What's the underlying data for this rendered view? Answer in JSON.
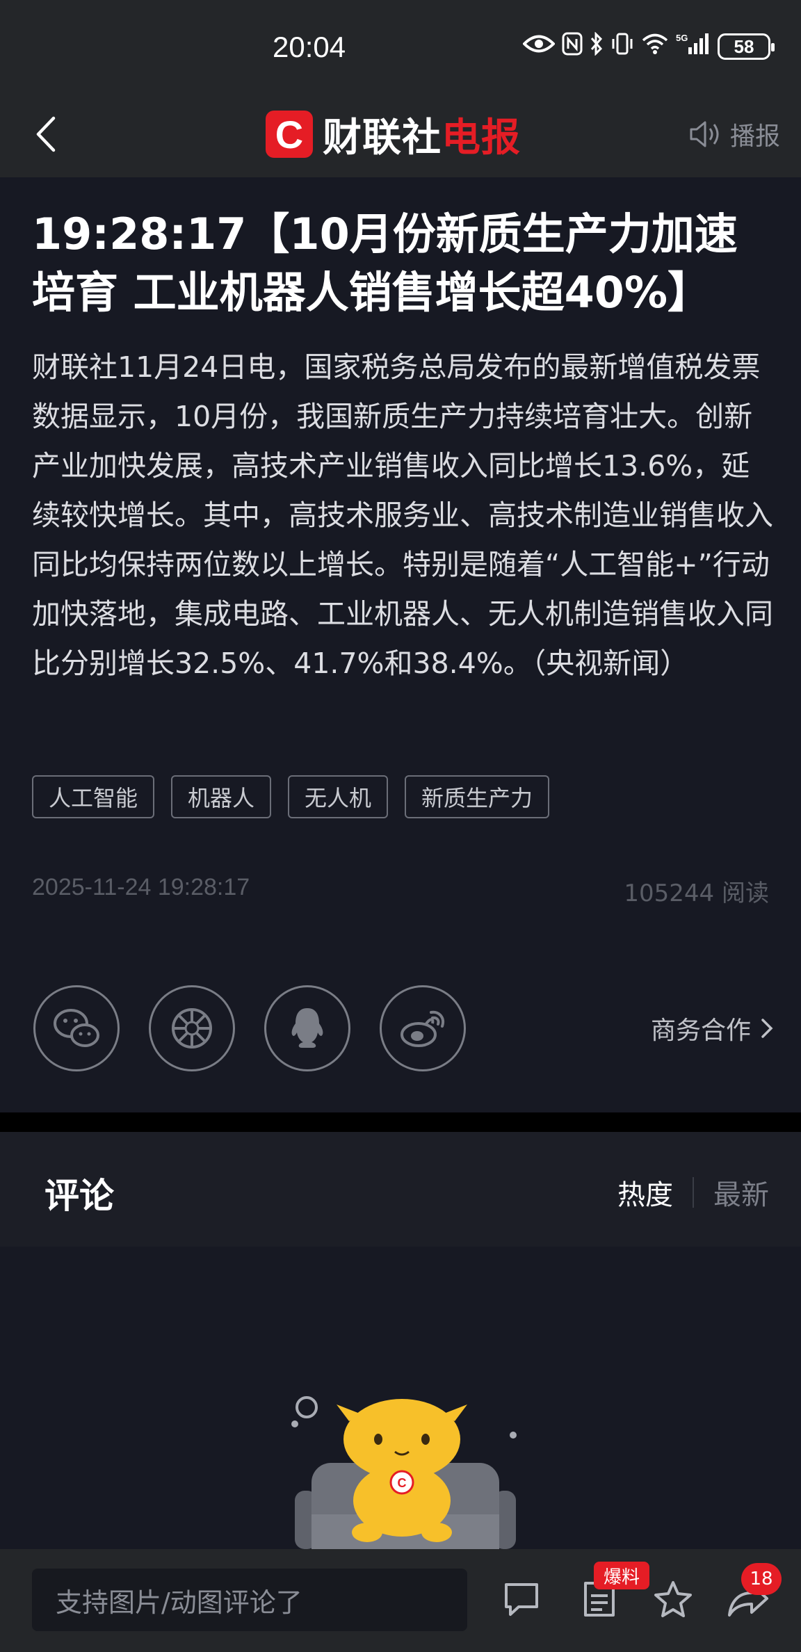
{
  "status_bar": {
    "time": "20:04",
    "network": "5G",
    "battery": "58"
  },
  "header": {
    "logo_letter": "C",
    "logo_white": "财联社",
    "logo_red": "电报",
    "broadcast_label": "播报"
  },
  "article": {
    "title": "19:28:17【10月份新质生产力加速培育 工业机器人销售增长超40%】",
    "body": "财联社11月24日电，国家税务总局发布的最新增值税发票数据显示，10月份，我国新质生产力持续培育壮大。创新产业加快发展，高技术产业销售收入同比增长13.6%，延续较快增长。其中，高技术服务业、高技术制造业销售收入同比均保持两位数以上增长。特别是随着“人工智能+”行动加快落地，集成电路、工业机器人、无人机制造销售收入同比分别增长32.5%、41.7%和38.4%。（央视新闻）",
    "tags": [
      "人工智能",
      "机器人",
      "无人机",
      "新质生产力"
    ],
    "date": "2025-11-24 19:28:17",
    "reads": "105244 阅读",
    "business_label": "商务合作"
  },
  "share_icons": [
    "wechat-icon",
    "moments-icon",
    "qq-icon",
    "weibo-icon"
  ],
  "comments": {
    "title": "评论",
    "sort_hot": "热度",
    "sort_new": "最新"
  },
  "bottom_bar": {
    "input_placeholder": "支持图片/动图评论了",
    "report_badge": "爆料",
    "share_count": "18"
  },
  "colors": {
    "accent": "#e51d25",
    "background": "#171923",
    "bar": "#242629"
  }
}
